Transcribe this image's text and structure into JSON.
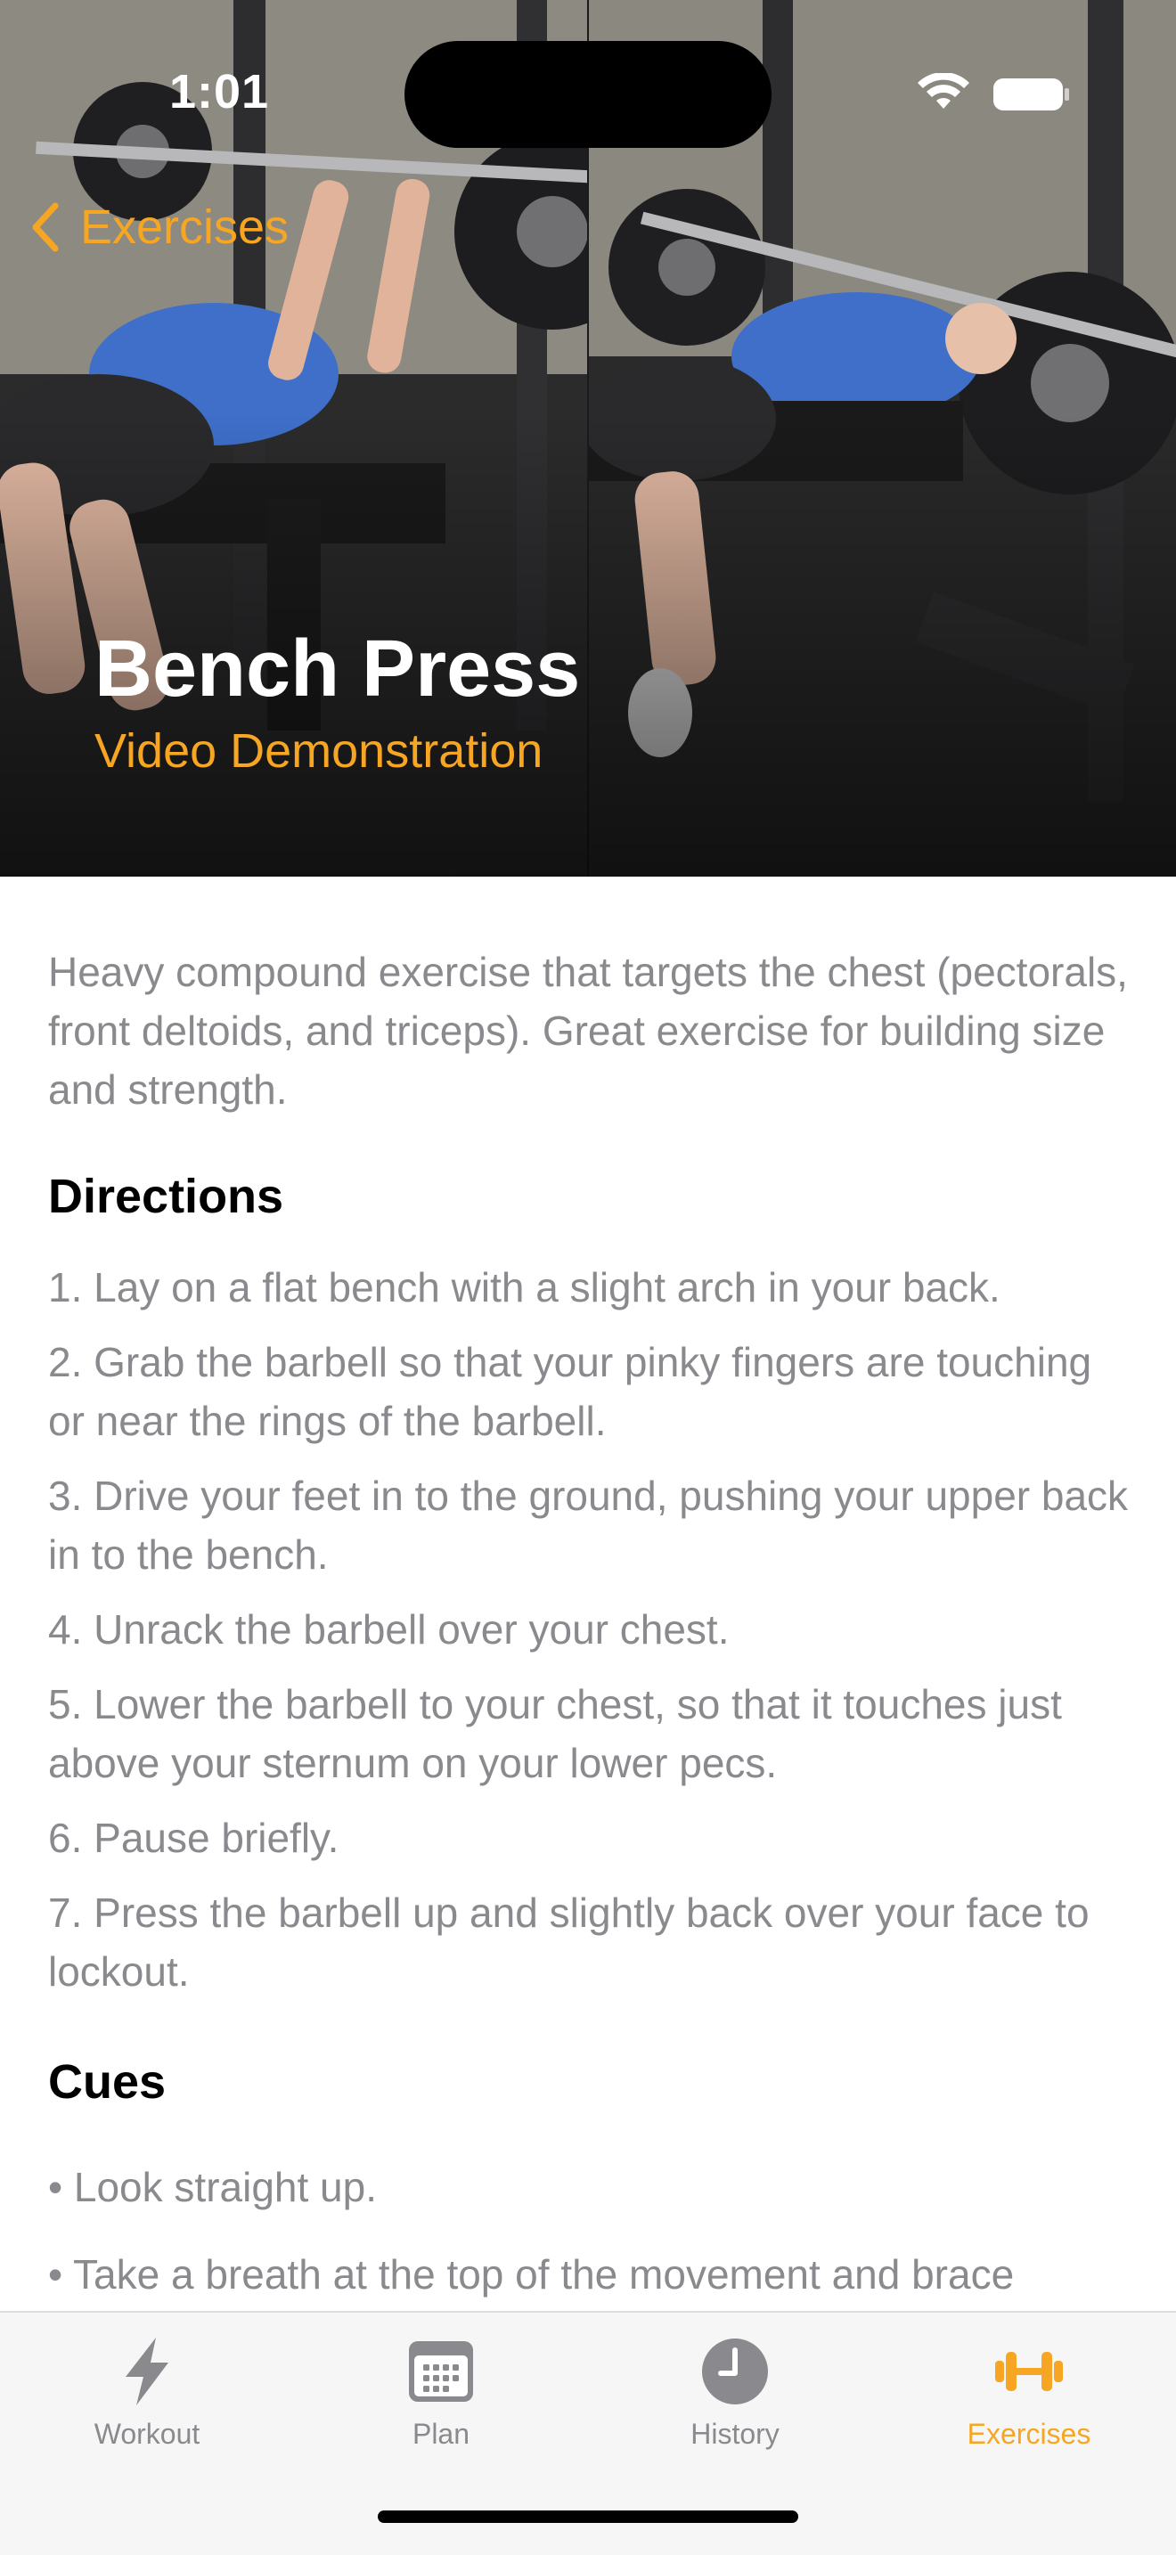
{
  "status_bar": {
    "time": "1:01"
  },
  "nav": {
    "back_label": "Exercises"
  },
  "hero": {
    "title": "Bench Press",
    "subtitle": "Video Demonstration"
  },
  "exercise": {
    "description": "Heavy compound exercise that targets the chest (pectorals, front deltoids, and triceps). Great exercise for building size and strength.",
    "directions_heading": "Directions",
    "directions": [
      "1. Lay on a flat bench with a slight arch in your back.",
      "2. Grab the barbell so that your pinky fingers are touching or near the rings of the barbell.",
      "3. Drive your feet in to the ground, pushing your upper back in to the bench.",
      "4. Unrack the barbell over your chest.",
      "5. Lower the barbell to your chest, so that it touches just above your sternum on your lower pecs.",
      "6. Pause briefly.",
      "7. Press the barbell up and slightly back over your face to lockout."
    ],
    "cues_heading": "Cues",
    "cues": [
      "• Look straight up.",
      "• Take a breath at the top of the movement and brace"
    ]
  },
  "tab_bar": {
    "tabs": [
      {
        "label": "Workout",
        "icon": "bolt-icon",
        "active": false
      },
      {
        "label": "Plan",
        "icon": "calendar-icon",
        "active": false
      },
      {
        "label": "History",
        "icon": "clock-icon",
        "active": false
      },
      {
        "label": "Exercises",
        "icon": "dumbbell-icon",
        "active": true
      }
    ]
  },
  "colors": {
    "accent": "#f6a623",
    "secondary_text": "#8a8a8e",
    "tab_inactive": "#8a8a8e",
    "tab_bar_background": "#f6f6f7"
  }
}
